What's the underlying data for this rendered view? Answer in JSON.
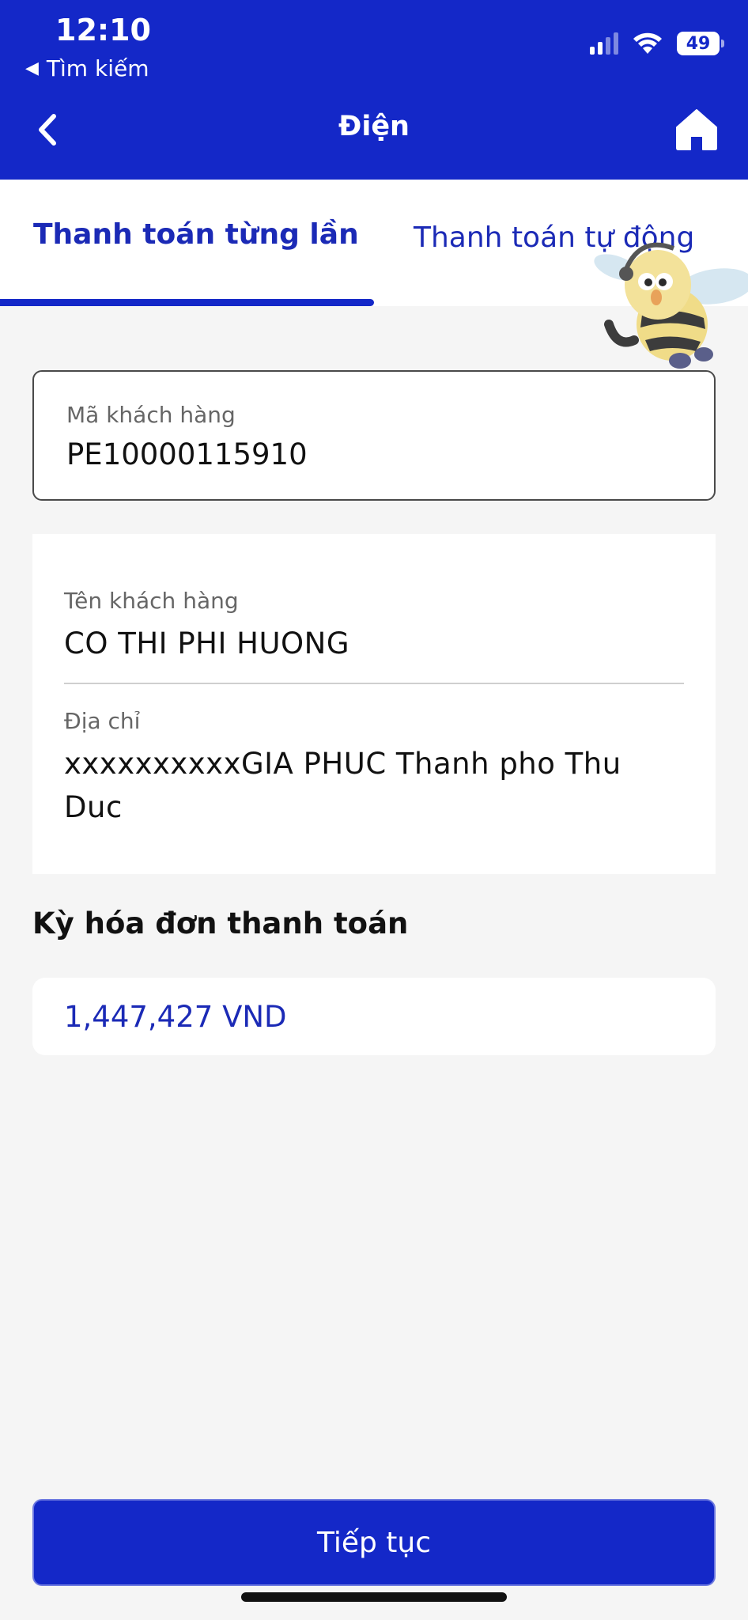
{
  "status_bar": {
    "time": "12:10",
    "back_app_label": "Tìm kiếm",
    "battery_level": "49"
  },
  "header": {
    "title": "Điện",
    "back_icon": "chevron-left-icon",
    "home_icon": "home-icon"
  },
  "tabs": [
    {
      "label": "Thanh toán từng lần",
      "active": true
    },
    {
      "label": "Thanh toán tự động",
      "active": false
    }
  ],
  "customer_code": {
    "label": "Mã khách hàng",
    "value": "PE10000115910"
  },
  "customer_info": {
    "name_label": "Tên khách hàng",
    "name_value": "CO THI PHI HUONG",
    "address_label": "Địa chỉ",
    "address_value": "xxxxxxxxxxGIA PHUC Thanh pho Thu Duc"
  },
  "billing": {
    "section_title": "Kỳ hóa đơn thanh toán",
    "amount": "1,447,427 VND"
  },
  "actions": {
    "continue_label": "Tiếp tục"
  },
  "colors": {
    "brand": "#1428c8",
    "accent_text": "#1b2ab6",
    "background": "#f5f5f5"
  }
}
